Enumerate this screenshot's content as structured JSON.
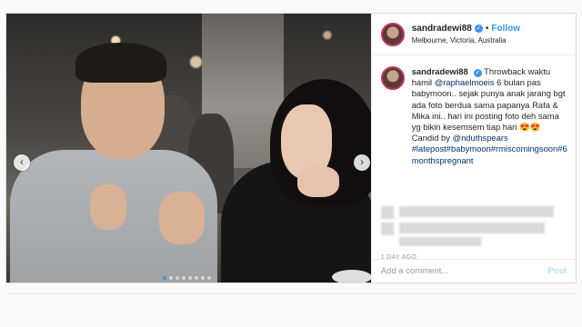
{
  "post": {
    "username": "sandradewi88",
    "follow_label": "Follow",
    "separator": "•",
    "location": "Melbourne, Victoria, Australia",
    "caption": {
      "username": "sandradewi88",
      "line_a": "Throwback waktu hamil",
      "mention_1": "@raphaelmoeis",
      "line_b": "6 bulan pas babymoon.. sejak punya anak jarang bgt ada foto berdua sama papanya Rafa & Mika ini.. hari ini posting foto deh sama yg bikin kesemsem tiap hari",
      "emoji": "😍😍",
      "candid_prefix": "Candid by",
      "mention_2": "@nduthspears",
      "hashtags": "#latepost#babymoon#rmiscomingsoon#6monthspregnant"
    },
    "timestamp": "1 DAY AGO",
    "comment_placeholder": "Add a comment...",
    "post_label": "Post",
    "carousel": {
      "slides": 8,
      "active_index": 0
    },
    "prev_arrow": "‹",
    "next_arrow": "›"
  },
  "colors": {
    "accent_blue": "#3897f0",
    "link_dark": "#003569",
    "post_disabled": "#b2dffc"
  }
}
